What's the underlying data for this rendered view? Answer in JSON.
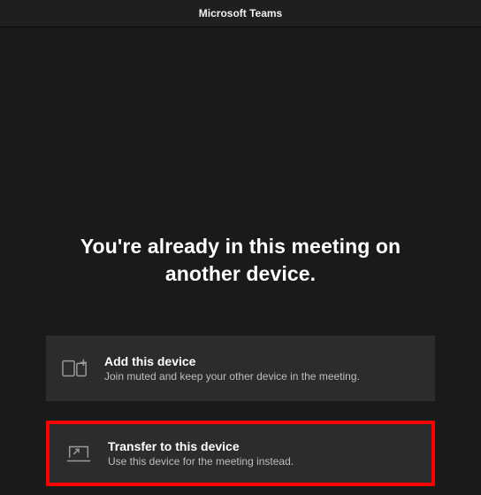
{
  "titlebar": {
    "title": "Microsoft Teams"
  },
  "panel": {
    "heading": "You're already in this meeting on another device."
  },
  "options": {
    "add": {
      "title": "Add this device",
      "subtitle": "Join muted and keep your other device in the meeting."
    },
    "transfer": {
      "title": "Transfer to this device",
      "subtitle": "Use this device for the meeting instead."
    }
  }
}
